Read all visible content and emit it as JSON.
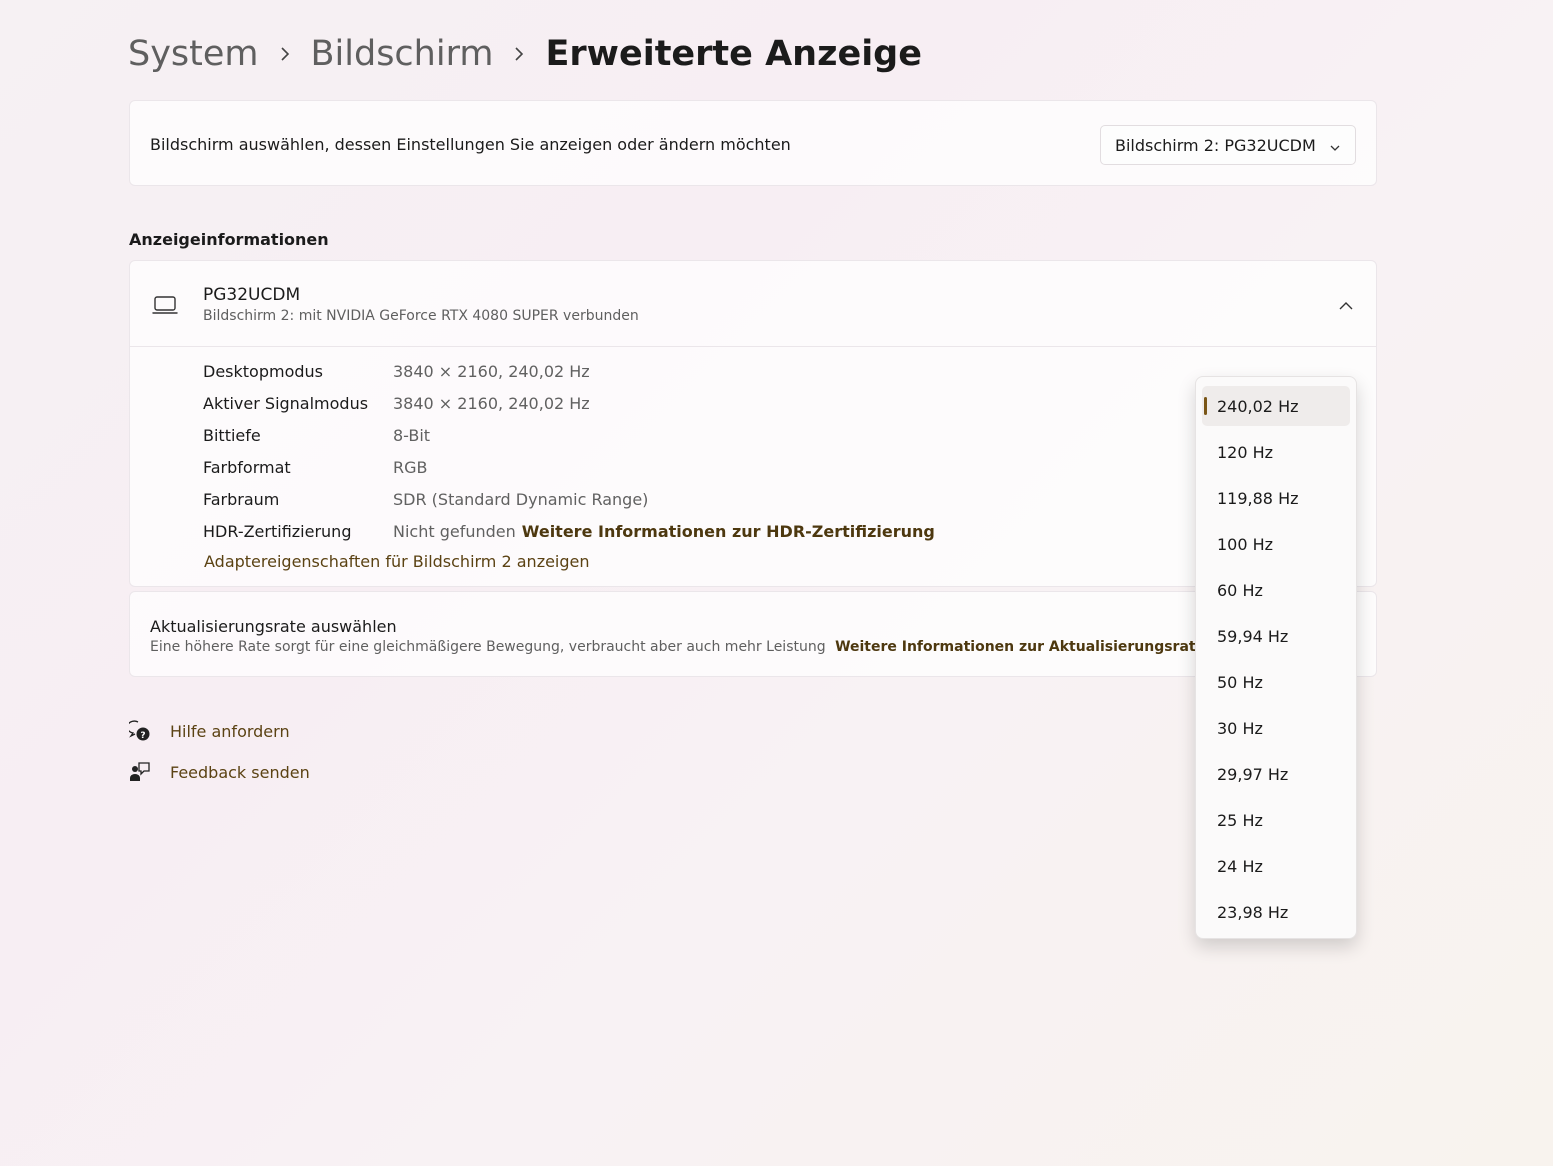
{
  "breadcrumb": {
    "items": [
      "System",
      "Bildschirm",
      "Erweiterte Anzeige"
    ]
  },
  "display_select": {
    "label": "Bildschirm auswählen, dessen Einstellungen Sie anzeigen oder ändern möchten",
    "value": "Bildschirm 2: PG32UCDM"
  },
  "display_info": {
    "section_title": "Anzeigeinformationen",
    "monitor_name": "PG32UCDM",
    "monitor_subtitle": "Bildschirm 2: mit NVIDIA GeForce RTX 4080 SUPER verbunden",
    "rows": [
      {
        "label": "Desktopmodus",
        "value": "3840 × 2160, 240,02 Hz"
      },
      {
        "label": "Aktiver Signalmodus",
        "value": "3840 × 2160, 240,02 Hz"
      },
      {
        "label": "Bittiefe",
        "value": "8-Bit"
      },
      {
        "label": "Farbformat",
        "value": "RGB"
      },
      {
        "label": "Farbraum",
        "value": "SDR (Standard Dynamic Range)"
      }
    ],
    "hdr_label": "HDR-Zertifizierung",
    "hdr_value": "Nicht gefunden",
    "hdr_link": "Weitere Informationen zur HDR-Zertifizierung",
    "adapter_link": "Adaptereigenschaften für Bildschirm 2 anzeigen"
  },
  "refresh_rate": {
    "title": "Aktualisierungsrate auswählen",
    "description": "Eine höhere Rate sorgt für eine gleichmäßigere Bewegung, verbraucht aber auch mehr Leistung",
    "link": "Weitere Informationen zur Aktualisierungsrate",
    "options": [
      "240,02 Hz",
      "120 Hz",
      "119,88 Hz",
      "100 Hz",
      "60 Hz",
      "59,94 Hz",
      "50 Hz",
      "30 Hz",
      "29,97 Hz",
      "25 Hz",
      "24 Hz",
      "23,98 Hz"
    ],
    "selected": "240,02 Hz"
  },
  "footer": {
    "help": "Hilfe anfordern",
    "feedback": "Feedback senden"
  },
  "colors": {
    "accent": "#7a5617",
    "link": "#5b4213"
  },
  "icons": {
    "monitor": "laptop-icon",
    "expand": "chevron-up-icon",
    "select": "chevron-down-icon",
    "breadcrumb_sep": "chevron-right-icon",
    "help": "help-chat-icon",
    "feedback": "feedback-person-icon"
  }
}
